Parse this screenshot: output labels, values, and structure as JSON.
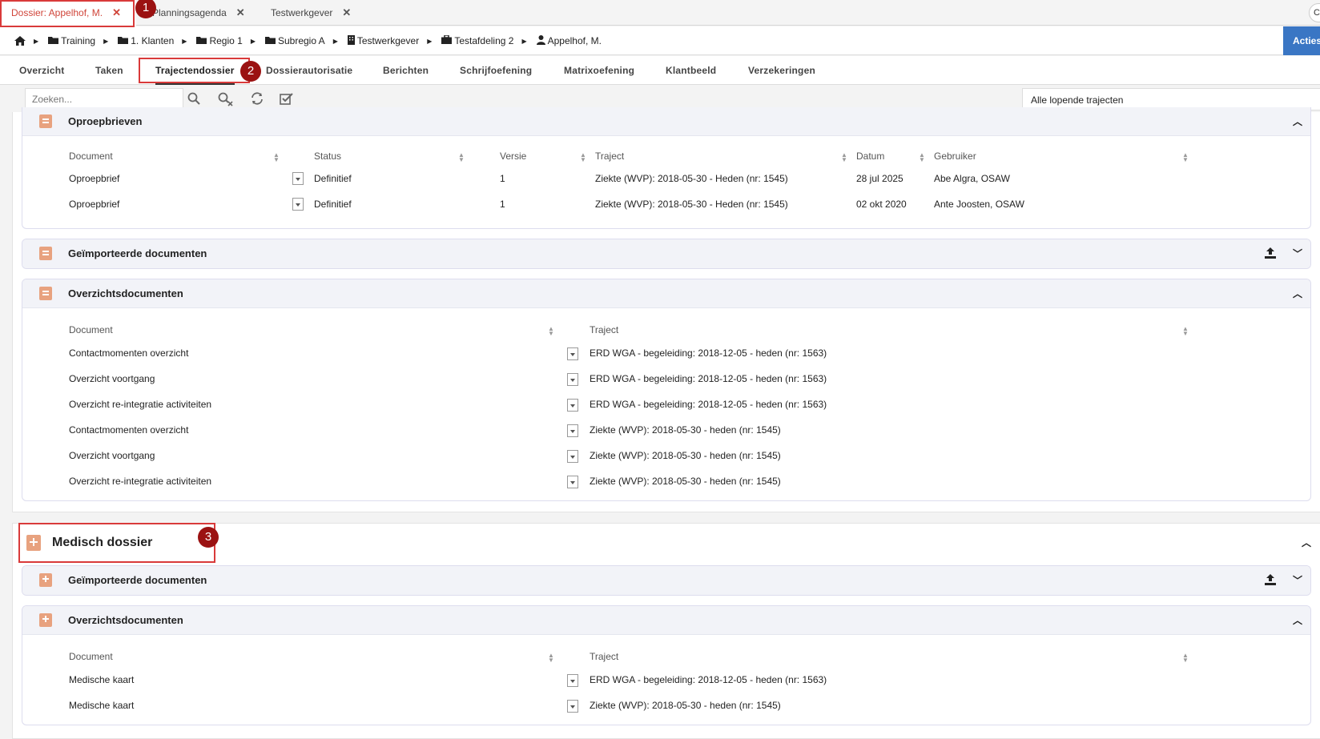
{
  "top_tabs": [
    {
      "label": "Dossier: Appelhof, M.",
      "close": "✕"
    },
    {
      "label": "Planningsagenda",
      "close": "✕"
    },
    {
      "label": "Testwerkgever",
      "close": "✕"
    }
  ],
  "top_right_label": "C",
  "breadcrumb": [
    "Training",
    "1. Klanten",
    "Regio 1",
    "Subregio A",
    "Testwerkgever",
    "Testafdeling 2",
    "Appelhof, M."
  ],
  "acties_label": "Acties",
  "main_tabs": [
    "Overzicht",
    "Taken",
    "Trajectendossier",
    "Dossierautorisatie",
    "Berichten",
    "Schrijfoefening",
    "Matrixoefening",
    "Klantbeeld",
    "Verzekeringen"
  ],
  "active_main_tab": "Trajectendossier",
  "search": {
    "placeholder": "Zoeken..."
  },
  "filter_select": "Alle lopende trajecten",
  "oproepbrieven": {
    "title": "Oproepbrieven",
    "columns": [
      "Document",
      "Status",
      "Versie",
      "Traject",
      "Datum",
      "Gebruiker"
    ],
    "rows": [
      {
        "document": "Oproepbrief",
        "status": "Definitief",
        "versie": "1",
        "traject": "Ziekte (WVP): 2018-05-30 - Heden (nr: 1545)",
        "datum": "28 jul 2025",
        "gebruiker": "Abe Algra, OSAW"
      },
      {
        "document": "Oproepbrief",
        "status": "Definitief",
        "versie": "1",
        "traject": "Ziekte (WVP): 2018-05-30 - Heden (nr: 1545)",
        "datum": "02 okt 2020",
        "gebruiker": "Ante Joosten, OSAW"
      }
    ]
  },
  "geimporteerd_1": {
    "title": "Geïmporteerde documenten"
  },
  "overzicht_1": {
    "title": "Overzichtsdocumenten",
    "columns": [
      "Document",
      "Traject"
    ],
    "rows": [
      {
        "document": "Contactmomenten overzicht",
        "traject": "ERD WGA - begeleiding: 2018-12-05 - heden (nr: 1563)"
      },
      {
        "document": "Overzicht voortgang",
        "traject": "ERD WGA - begeleiding: 2018-12-05 - heden (nr: 1563)"
      },
      {
        "document": "Overzicht re-integratie activiteiten",
        "traject": "ERD WGA - begeleiding: 2018-12-05 - heden (nr: 1563)"
      },
      {
        "document": "Contactmomenten overzicht",
        "traject": "Ziekte (WVP): 2018-05-30 - heden (nr: 1545)"
      },
      {
        "document": "Overzicht voortgang",
        "traject": "Ziekte (WVP): 2018-05-30 - heden (nr: 1545)"
      },
      {
        "document": "Overzicht re-integratie activiteiten",
        "traject": "Ziekte (WVP): 2018-05-30 - heden (nr: 1545)"
      }
    ]
  },
  "medisch": {
    "title": "Medisch dossier"
  },
  "geimporteerd_2": {
    "title": "Geïmporteerde documenten"
  },
  "overzicht_2": {
    "title": "Overzichtsdocumenten",
    "columns": [
      "Document",
      "Traject"
    ],
    "rows": [
      {
        "document": "Medische kaart",
        "traject": "ERD WGA - begeleiding: 2018-12-05 - heden (nr: 1563)"
      },
      {
        "document": "Medische kaart",
        "traject": "Ziekte (WVP): 2018-05-30 - heden (nr: 1545)"
      }
    ]
  },
  "annotations": [
    "1",
    "2",
    "3"
  ],
  "colors": {
    "accent_red": "#d93a3a",
    "badge": "#9b1212",
    "acties_blue": "#3a76c4",
    "doc_icon": "#e8a27f"
  }
}
